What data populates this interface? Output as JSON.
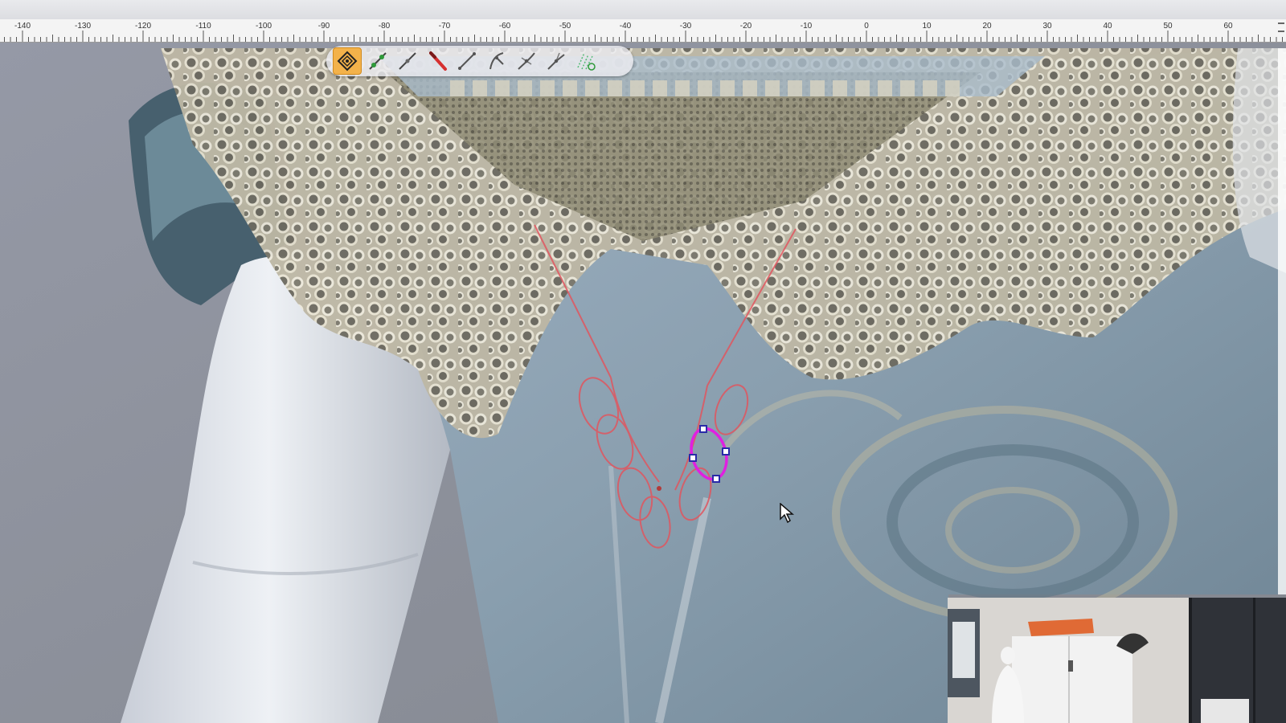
{
  "ruler": {
    "labels": [
      "-140",
      "-130",
      "-120",
      "-110",
      "-100",
      "-90",
      "-80",
      "-70",
      "-60",
      "-50",
      "-40",
      "-30",
      "-20",
      "-10",
      "0",
      "10",
      "20",
      "30",
      "40",
      "50",
      "60"
    ]
  },
  "toolbar": {
    "tools": [
      {
        "icon": "node-select-icon",
        "active": true
      },
      {
        "icon": "add-node-icon",
        "active": false
      },
      {
        "icon": "line-tool-icon",
        "active": false
      },
      {
        "icon": "knife-tool-icon",
        "active": false
      },
      {
        "icon": "straight-segment-icon",
        "active": false
      },
      {
        "icon": "curve-branch-icon",
        "active": false
      },
      {
        "icon": "smooth-node-icon",
        "active": false
      },
      {
        "icon": "cusp-node-icon",
        "active": false
      },
      {
        "icon": "auto-trace-icon",
        "active": false
      }
    ]
  },
  "colors": {
    "accent": "#f3b24a",
    "selection_path": "#e020e0",
    "handle": "#2a2aa8",
    "guide_path": "#e0565f"
  }
}
